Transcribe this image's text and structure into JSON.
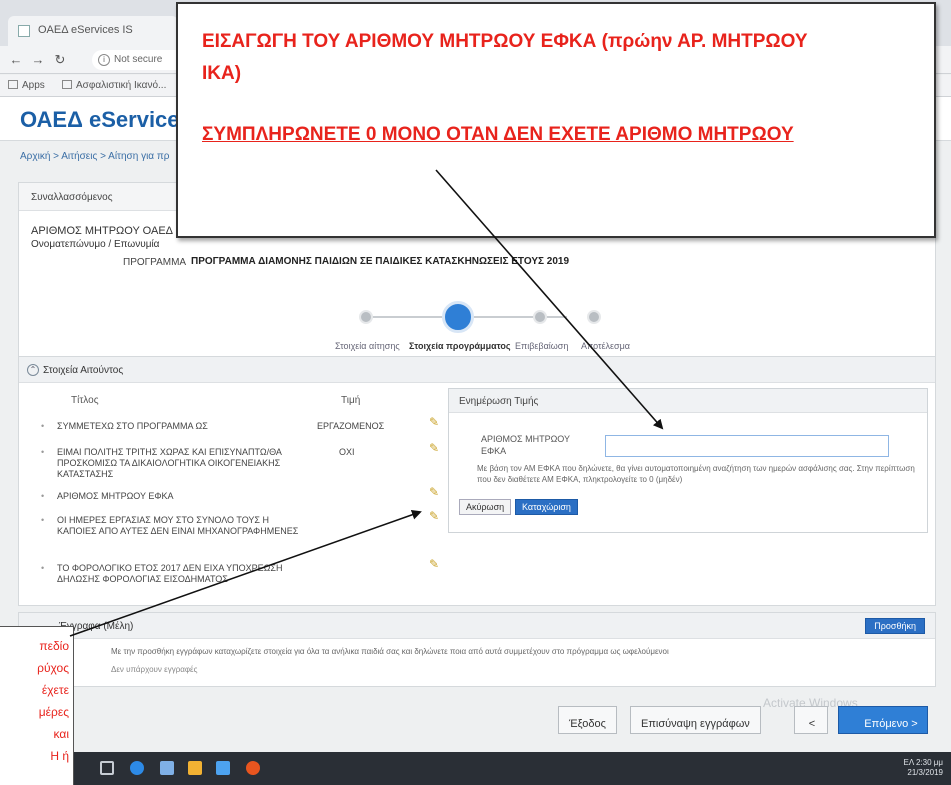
{
  "browser": {
    "tab_title": "OAEΔ eServices IS",
    "url": "Not secure",
    "bookmarks": [
      "Apps",
      "Ασφαλιστική Ικανό..."
    ]
  },
  "header": {
    "brand": "ΟΑΕΔ eServices"
  },
  "breadcrumb": "Αρχική > Αιτήσεις > Αίτηση για πρ",
  "insured": {
    "head": "Συναλλασσόμενος",
    "am_label": "ΑΡΙΘΜΟΣ ΜΗΤΡΩΟΥ ΟΑΕΔ",
    "name_label": "Ονοματεπώνυμο / Επωνυμία",
    "program_label": "ΠΡΟΓΡΑΜΜΑ",
    "program_value": "ΠΡΟΓΡΑΜΜΑ ΔΙΑΜΟΝΗΣ ΠΑΙΔΙΩΝ ΣΕ ΠΑΙΔΙΚΕΣ ΚΑΤΑΣΚΗΝΩΣΕΙΣ ΕΤΟΥΣ 2019"
  },
  "stepper": {
    "steps": [
      "Στοιχεία αίτησης",
      "Στοιχεία προγράμματος",
      "Επιβεβαίωση",
      "Αποτέλεσμα"
    ],
    "active_index": 1
  },
  "details": {
    "head": "Στοιχεία Αιτούντος",
    "col_title": "Τίτλος",
    "col_value": "Τιμή",
    "rows": [
      {
        "title": "ΣΥΜΜΕΤΕΧΩ ΣΤΟ ΠΡΟΓΡΑΜΜΑ ΩΣ",
        "value": "ΕΡΓΑΖΟΜΕΝΟΣ"
      },
      {
        "title": "ΕΙΜΑΙ ΠΟΛΙΤΗΣ ΤΡΙΤΗΣ ΧΩΡΑΣ ΚΑΙ ΕΠΙΣΥΝΑΠΤΩ/ΘΑ ΠΡΟΣΚΟΜΙΣΩ ΤΑ ΔΙΚΑΙΟΛΟΓΗΤΙΚΑ ΟΙΚΟΓΕΝΕΙΑΚΗΣ ΚΑΤΑΣΤΑΣΗΣ",
        "value": "ΟΧΙ"
      },
      {
        "title": "ΑΡΙΘΜΟΣ ΜΗΤΡΩΟΥ ΕΦΚΑ",
        "value": ""
      },
      {
        "title": "ΟΙ ΗΜΕΡΕΣ ΕΡΓΑΣΙΑΣ ΜΟΥ ΣΤΟ ΣΥΝΟΛΟ ΤΟΥΣ Η ΚΑΠΟΙΕΣ ΑΠΟ ΑΥΤΕΣ ΔΕΝ ΕΙΝΑΙ ΜΗΧΑΝΟΓΡΑΦΗΜΕΝΕΣ",
        "value": ""
      },
      {
        "title": "ΤΟ ΦΟΡΟΛΟΓΙΚΟ ΕΤΟΣ 2017 ΔΕΝ ΕΙΧΑ ΥΠΟΧΡΕΩΣΗ ΔΗΛΩΣΗΣ ΦΟΡΟΛΟΓΙΑΣ ΕΙΣΟΔΗΜΑΤΟΣ",
        "value": ""
      }
    ]
  },
  "edit": {
    "head": "Ενημέρωση Τιμής",
    "label": "ΑΡΙΘΜΟΣ ΜΗΤΡΩΟΥ ΕΦΚΑ",
    "value": "",
    "help": "Με βάση τον ΑΜ ΕΦΚΑ που δηλώνετε, θα γίνει αυτοματοποιημένη αναζήτηση των ημερών ασφάλισης σας. Στην περίπτωση που δεν διαθέτετε ΑΜ ΕΦΚΑ, πληκτρολογείτε το 0 (μηδέν)",
    "cancel": "Ακύρωση",
    "save": "Καταχώριση"
  },
  "docs": {
    "head": "Έγγραφα (Μέλη)",
    "add": "Προσθήκη",
    "text": "Με την προσθήκη εγγράφων καταχωρίζετε στοιχεία για όλα τα ανήλικα παιδιά σας και δηλώνετε ποια από αυτά συμμετέχουν στο πρόγραμμα ως ωφελούμενοι",
    "empty": "Δεν υπάρχουν εγγραφές"
  },
  "actions": {
    "exit": "Έξοδος",
    "view_docs": "Επισύναψη εγγράφων",
    "back": "<",
    "next": "Επόμενο >",
    "watermark": "Activate Windows"
  },
  "taskbar": {
    "time": "2:30 μμ",
    "date": "21/3/2019",
    "lang": "ΕΛ"
  },
  "annotation": {
    "line1": "ΕΙΣΑΓΩΓΗ ΤΟΥ ΑΡΙΘΜΟΥ ΜΗΤΡΩΟΥ ΕΦΚΑ (πρώην ΑΡ. ΜΗΤΡΩΟΥ ΙΚΑ)",
    "line2": "ΣΥΜΠΛΗΡΩΝΕΤΕ 0 ΜΟΝΟ ΟΤΑΝ ΔΕΝ ΕΧΕΤΕ ΑΡΙΘΜΟ ΜΗΤΡΩΟΥ",
    "color": "#e8231c",
    "side_lines": [
      "πεδίο",
      "ρύχος",
      "έχετε",
      "μέρες",
      "και",
      "Η ή"
    ]
  }
}
